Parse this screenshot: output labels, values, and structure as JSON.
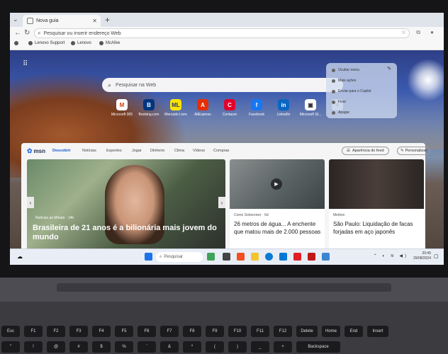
{
  "browser": {
    "tab_title": "Nova guia",
    "new_tab_symbol": "+",
    "address_placeholder": "Pesquisar ou inserir endereço Web",
    "favorites": [
      "Lenovo Support",
      "Lenovo",
      "McAfee"
    ]
  },
  "ntp": {
    "search_placeholder": "Pesquisar na Web",
    "tiles": [
      {
        "label": "Microsoft 365",
        "glyph": "M",
        "color": "#d83b01"
      },
      {
        "label": "Booking.com",
        "glyph": "B",
        "color": "#003580"
      },
      {
        "label": "Mercado Livre",
        "glyph": "ML",
        "color": "#ffe600"
      },
      {
        "label": "AliExpress",
        "glyph": "A",
        "color": "#e62e04"
      },
      {
        "label": "Centauro",
        "glyph": "C",
        "color": "#e4002b"
      },
      {
        "label": "Facebook",
        "glyph": "f",
        "color": "#1877f2"
      },
      {
        "label": "LinkedIn",
        "glyph": "in",
        "color": "#0a66c2"
      },
      {
        "label": "Microsoft St...",
        "glyph": "▣",
        "color": "#333333"
      },
      {
        "label": "",
        "glyph": "+",
        "color": "#666666"
      }
    ],
    "menu": {
      "items": [
        "Ocultar menu",
        "Mais ações",
        "Enviar para o Copilot",
        "Fixar",
        "Apagar"
      ]
    }
  },
  "msn": {
    "logo": "msn",
    "nav": [
      "Descobrir",
      "Notícias",
      "Esportes",
      "Jogar",
      "Dinheiro",
      "Clima",
      "Vídeos",
      "Compras"
    ],
    "feed_settings": "Aparência do feed",
    "personalize": "Personalizar",
    "hero": {
      "source": "Notícias ao Minuto · 14h",
      "headline": "Brasileira de 21 anos é a bilionária mais jovem do mundo"
    },
    "cards": [
      {
        "source": "Como Sobreviver · 6d",
        "title": "26 metros de água... A enchente que matou mais de 2.000 pessoas"
      },
      {
        "source": "Mettion",
        "title": "São Paulo: Liquidação de facas forjadas em aço japonês"
      }
    ]
  },
  "taskbar": {
    "search_placeholder": "Pesquisar",
    "time": "20:45",
    "date": "29/08/2024"
  },
  "keyboard": {
    "fn_row": [
      "Esc",
      "F1",
      "F2",
      "F3",
      "F4",
      "F5",
      "F6",
      "F7",
      "F8",
      "F9",
      "F10",
      "F11",
      "F12",
      "Delete",
      "Home",
      "End",
      "Insert"
    ],
    "num_row": [
      "\"",
      "!",
      "@",
      "#",
      "$",
      "%",
      "¨",
      "&",
      "*",
      "(",
      ")",
      "_",
      "+",
      "Backspace"
    ]
  }
}
